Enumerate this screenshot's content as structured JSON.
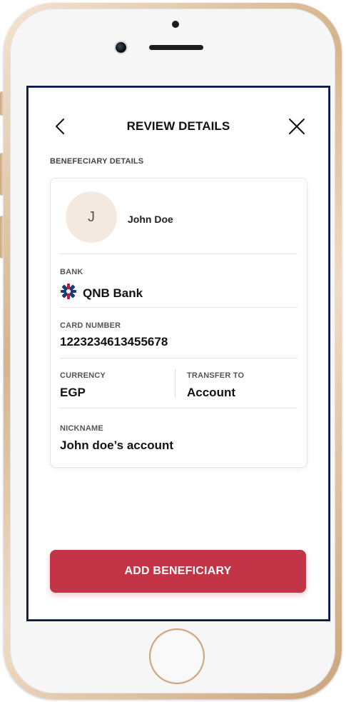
{
  "header": {
    "title": "REVIEW DETAILS",
    "back_icon": "chevron-left-icon",
    "close_icon": "close-icon"
  },
  "section": {
    "label": "BENEFECIARY DETAILS"
  },
  "beneficiary": {
    "initial": "J",
    "name": "John Doe"
  },
  "fields": {
    "bank_label": "BANK",
    "bank_value": "QNB Bank",
    "bank_logo_icon": "qnb-bank-logo-icon",
    "card_label": "CARD NUMBER",
    "card_value": "1223234613455678",
    "currency_label": "CURRENCY",
    "currency_value": "EGP",
    "transfer_label": "TRANSFER TO",
    "transfer_value": "Account",
    "nickname_label": "NICKNAME",
    "nickname_value": "John doe’s account"
  },
  "actions": {
    "primary_label": "ADD BENEFICIARY"
  },
  "colors": {
    "primary": "#c23446",
    "avatar_bg": "#f3e9e0",
    "logo_navy": "#1c3a73",
    "logo_red": "#c4162f"
  }
}
